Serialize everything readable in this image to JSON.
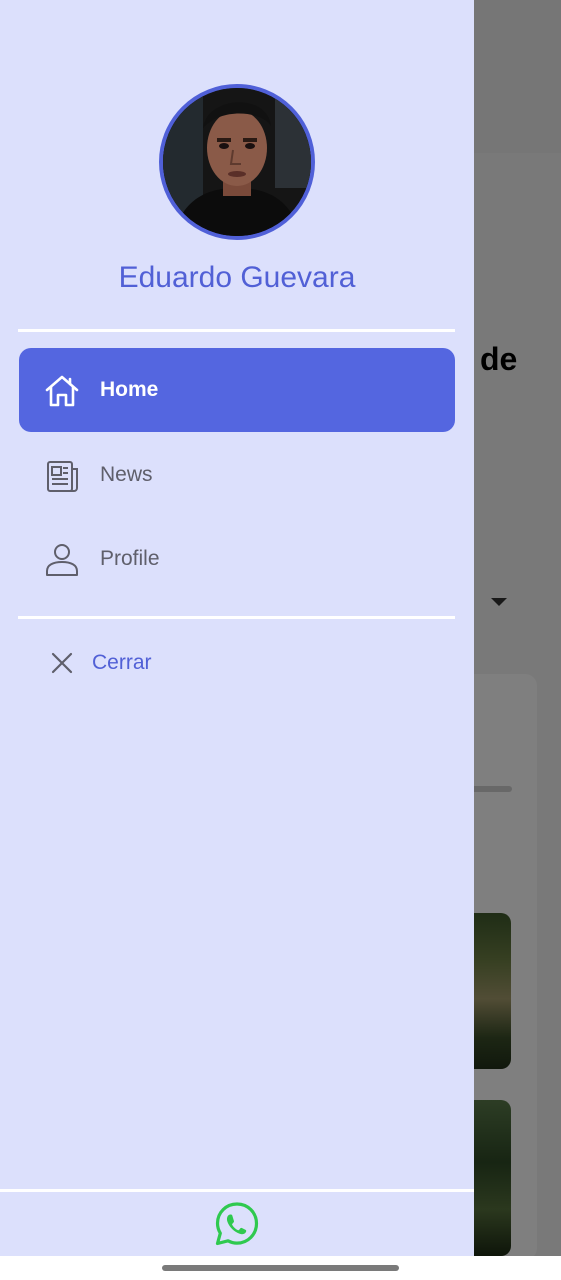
{
  "drawer": {
    "user_name": "Eduardo Guevara",
    "nav_items": [
      {
        "label": "Home",
        "icon": "home-icon",
        "active": true
      },
      {
        "label": "News",
        "icon": "newspaper-icon",
        "active": false
      },
      {
        "label": "Profile",
        "icon": "person-icon",
        "active": false
      }
    ],
    "close_label": "Cerrar",
    "footer_icon": "whatsapp-icon"
  },
  "background": {
    "heading_fragment": "de"
  },
  "colors": {
    "drawer_bg": "#dce0fc",
    "accent": "#5466e0",
    "name_text": "#5160d6",
    "whatsapp": "#2fc94f"
  }
}
